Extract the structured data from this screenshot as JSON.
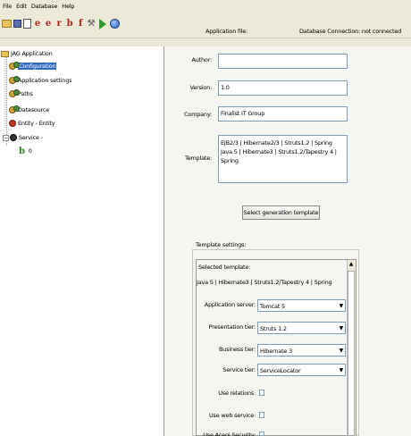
{
  "menu": [
    "File",
    "Edit",
    "Database",
    "Help"
  ],
  "toolbar": {
    "icons": [
      "open-folder-icon",
      "save-icon",
      "document-icon",
      "entity-e-icon",
      "entity-e-icon",
      "relation-r-icon",
      "bean-b-icon",
      "function-f-icon",
      "wrench-icon",
      "run-icon",
      "globe-icon"
    ],
    "glyphs": [
      "",
      "",
      "",
      "e",
      "e",
      "r",
      "b",
      "f",
      "⚒",
      "",
      ""
    ],
    "application_file_label": "Application file:",
    "db_connection_status": "Database Connection: not connected"
  },
  "tree": {
    "root": "JAG Application",
    "items": [
      "Configuration",
      "Application settings",
      "Paths",
      "Datasource",
      "Entity - Entity",
      "Service -"
    ],
    "service_child": "0"
  },
  "form": {
    "author_label": "Author:",
    "author_value": "",
    "version_label": "Version:",
    "version_value": "1.0",
    "company_label": "Company:",
    "company_value": "Finalist IT Group",
    "template_label": "Template:",
    "template_line1": "EJB2/3 | Hibernate2/3 | Struts1.2 | Spring",
    "template_line2": "Java 5 | Hibernate3 | Struts1.2/Tapestry 4 | Spring",
    "select_template_button": "Select generation template"
  },
  "template_settings": {
    "title": "Template settings:",
    "selected_template_label": "Selected template:",
    "selected_template_value": "Java 5 | Hibernate3 | Struts1.2/Tapestry 4 | Spring",
    "app_server_label": "Application server:",
    "app_server_value": "Tomcat 5",
    "presentation_label": "Presentation tier:",
    "presentation_value": "Struts 1.2",
    "business_label": "Business tier:",
    "business_value": "Hibernate 3",
    "service_label": "Service tier:",
    "service_value": "ServiceLocator",
    "relations_label": "Use relations:",
    "webservice_label": "Use web service:",
    "appserver_check_label": "Use Acegi Security:"
  },
  "colors": {
    "selection": "#316ac5",
    "window": "#ece9d8",
    "panel": "#f5f5f2"
  }
}
